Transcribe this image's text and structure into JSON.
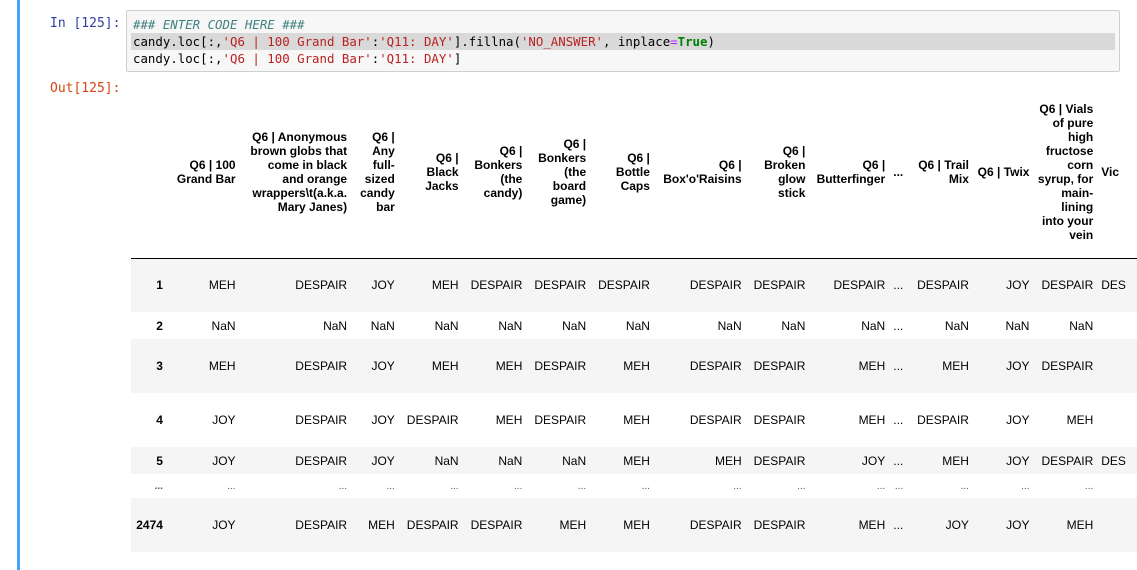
{
  "input_prompt": "In [125]:",
  "output_prompt": "Out[125]:",
  "code": {
    "comment": "### ENTER CODE HERE ###",
    "line2": {
      "a": "candy.loc[:,",
      "s1": "'Q6 | 100 Grand Bar'",
      "colon": ":",
      "s2": "'Q11: DAY'",
      "b": "].fillna(",
      "s3": "'NO_ANSWER'",
      "c": ", inplace",
      "eq": "=",
      "kw": "True",
      "d": ")"
    },
    "line3": {
      "a": "candy.loc[:,",
      "s1": "'Q6 | 100 Grand Bar'",
      "colon": ":",
      "s2": "'Q11: DAY'",
      "b": "]"
    }
  },
  "table": {
    "columns": [
      "Q6 | 100 Grand Bar",
      "Q6 | Anonymous brown globs that come in black and orange wrappers\\t(a.k.a. Mary Janes)",
      "Q6 | Any full-sized candy bar",
      "Q6 | Black Jacks",
      "Q6 | Bonkers (the candy)",
      "Q6 | Bonkers (the board game)",
      "Q6 | Bottle Caps",
      "Q6 | Box'o'Raisins",
      "Q6 | Broken glow stick",
      "Q6 | Butterfinger",
      "...",
      "Q6 | Trail Mix",
      "Q6 | Twix",
      "Q6 | Vials of pure high fructose corn syrup, for main-lining into your vein",
      "Vic"
    ],
    "rows": [
      {
        "index": "1",
        "cells": [
          "MEH",
          "DESPAIR",
          "JOY",
          "MEH",
          "DESPAIR",
          "DESPAIR",
          "DESPAIR",
          "DESPAIR",
          "DESPAIR",
          "DESPAIR",
          "...",
          "DESPAIR",
          "JOY",
          "DESPAIR",
          "DES"
        ]
      },
      {
        "index": "2",
        "cells": [
          "NaN",
          "NaN",
          "NaN",
          "NaN",
          "NaN",
          "NaN",
          "NaN",
          "NaN",
          "NaN",
          "NaN",
          "...",
          "NaN",
          "NaN",
          "NaN",
          ""
        ]
      },
      {
        "index": "3",
        "cells": [
          "MEH",
          "DESPAIR",
          "JOY",
          "MEH",
          "MEH",
          "DESPAIR",
          "MEH",
          "DESPAIR",
          "DESPAIR",
          "MEH",
          "...",
          "MEH",
          "JOY",
          "DESPAIR",
          ""
        ]
      },
      {
        "index": "4",
        "cells": [
          "JOY",
          "DESPAIR",
          "JOY",
          "DESPAIR",
          "MEH",
          "DESPAIR",
          "MEH",
          "DESPAIR",
          "DESPAIR",
          "MEH",
          "...",
          "DESPAIR",
          "JOY",
          "MEH",
          ""
        ]
      },
      {
        "index": "5",
        "cells": [
          "JOY",
          "DESPAIR",
          "JOY",
          "NaN",
          "NaN",
          "NaN",
          "MEH",
          "MEH",
          "DESPAIR",
          "JOY",
          "...",
          "MEH",
          "JOY",
          "DESPAIR",
          "DES"
        ]
      },
      {
        "index": "...",
        "cells": [
          "...",
          "...",
          "...",
          "...",
          "...",
          "...",
          "...",
          "...",
          "...",
          "...",
          "...",
          "...",
          "...",
          "...",
          ""
        ]
      },
      {
        "index": "2474",
        "cells": [
          "JOY",
          "DESPAIR",
          "MEH",
          "DESPAIR",
          "DESPAIR",
          "MEH",
          "MEH",
          "DESPAIR",
          "DESPAIR",
          "MEH",
          "...",
          "JOY",
          "JOY",
          "MEH",
          ""
        ]
      }
    ]
  }
}
